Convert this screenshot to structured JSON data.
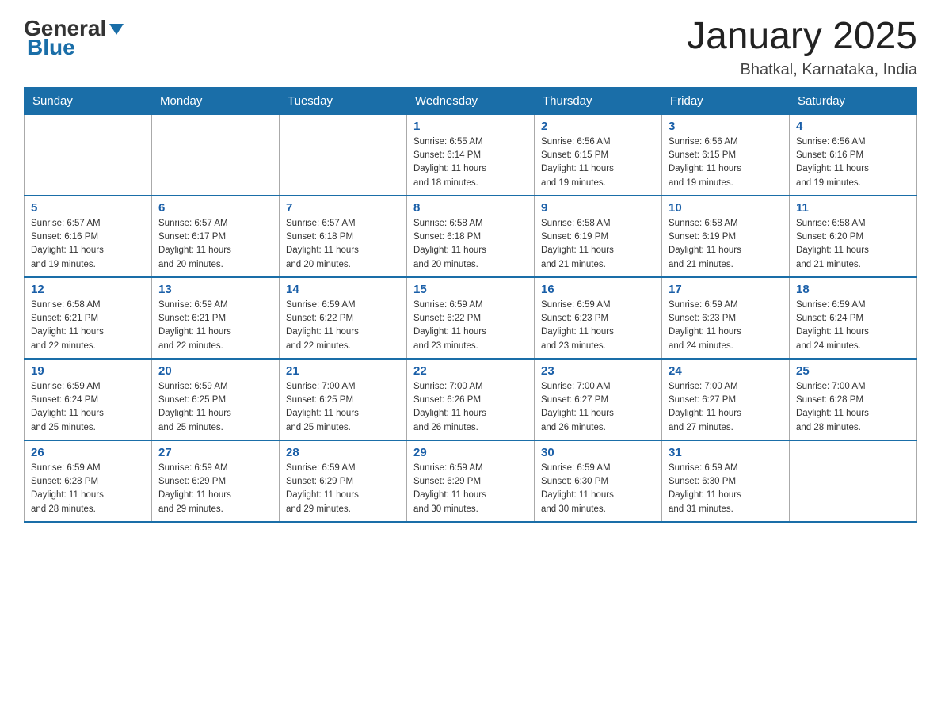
{
  "header": {
    "logo_general": "General",
    "logo_blue": "Blue",
    "month_title": "January 2025",
    "location": "Bhatkal, Karnataka, India"
  },
  "days_of_week": [
    "Sunday",
    "Monday",
    "Tuesday",
    "Wednesday",
    "Thursday",
    "Friday",
    "Saturday"
  ],
  "weeks": [
    [
      {
        "day": "",
        "info": ""
      },
      {
        "day": "",
        "info": ""
      },
      {
        "day": "",
        "info": ""
      },
      {
        "day": "1",
        "info": "Sunrise: 6:55 AM\nSunset: 6:14 PM\nDaylight: 11 hours\nand 18 minutes."
      },
      {
        "day": "2",
        "info": "Sunrise: 6:56 AM\nSunset: 6:15 PM\nDaylight: 11 hours\nand 19 minutes."
      },
      {
        "day": "3",
        "info": "Sunrise: 6:56 AM\nSunset: 6:15 PM\nDaylight: 11 hours\nand 19 minutes."
      },
      {
        "day": "4",
        "info": "Sunrise: 6:56 AM\nSunset: 6:16 PM\nDaylight: 11 hours\nand 19 minutes."
      }
    ],
    [
      {
        "day": "5",
        "info": "Sunrise: 6:57 AM\nSunset: 6:16 PM\nDaylight: 11 hours\nand 19 minutes."
      },
      {
        "day": "6",
        "info": "Sunrise: 6:57 AM\nSunset: 6:17 PM\nDaylight: 11 hours\nand 20 minutes."
      },
      {
        "day": "7",
        "info": "Sunrise: 6:57 AM\nSunset: 6:18 PM\nDaylight: 11 hours\nand 20 minutes."
      },
      {
        "day": "8",
        "info": "Sunrise: 6:58 AM\nSunset: 6:18 PM\nDaylight: 11 hours\nand 20 minutes."
      },
      {
        "day": "9",
        "info": "Sunrise: 6:58 AM\nSunset: 6:19 PM\nDaylight: 11 hours\nand 21 minutes."
      },
      {
        "day": "10",
        "info": "Sunrise: 6:58 AM\nSunset: 6:19 PM\nDaylight: 11 hours\nand 21 minutes."
      },
      {
        "day": "11",
        "info": "Sunrise: 6:58 AM\nSunset: 6:20 PM\nDaylight: 11 hours\nand 21 minutes."
      }
    ],
    [
      {
        "day": "12",
        "info": "Sunrise: 6:58 AM\nSunset: 6:21 PM\nDaylight: 11 hours\nand 22 minutes."
      },
      {
        "day": "13",
        "info": "Sunrise: 6:59 AM\nSunset: 6:21 PM\nDaylight: 11 hours\nand 22 minutes."
      },
      {
        "day": "14",
        "info": "Sunrise: 6:59 AM\nSunset: 6:22 PM\nDaylight: 11 hours\nand 22 minutes."
      },
      {
        "day": "15",
        "info": "Sunrise: 6:59 AM\nSunset: 6:22 PM\nDaylight: 11 hours\nand 23 minutes."
      },
      {
        "day": "16",
        "info": "Sunrise: 6:59 AM\nSunset: 6:23 PM\nDaylight: 11 hours\nand 23 minutes."
      },
      {
        "day": "17",
        "info": "Sunrise: 6:59 AM\nSunset: 6:23 PM\nDaylight: 11 hours\nand 24 minutes."
      },
      {
        "day": "18",
        "info": "Sunrise: 6:59 AM\nSunset: 6:24 PM\nDaylight: 11 hours\nand 24 minutes."
      }
    ],
    [
      {
        "day": "19",
        "info": "Sunrise: 6:59 AM\nSunset: 6:24 PM\nDaylight: 11 hours\nand 25 minutes."
      },
      {
        "day": "20",
        "info": "Sunrise: 6:59 AM\nSunset: 6:25 PM\nDaylight: 11 hours\nand 25 minutes."
      },
      {
        "day": "21",
        "info": "Sunrise: 7:00 AM\nSunset: 6:25 PM\nDaylight: 11 hours\nand 25 minutes."
      },
      {
        "day": "22",
        "info": "Sunrise: 7:00 AM\nSunset: 6:26 PM\nDaylight: 11 hours\nand 26 minutes."
      },
      {
        "day": "23",
        "info": "Sunrise: 7:00 AM\nSunset: 6:27 PM\nDaylight: 11 hours\nand 26 minutes."
      },
      {
        "day": "24",
        "info": "Sunrise: 7:00 AM\nSunset: 6:27 PM\nDaylight: 11 hours\nand 27 minutes."
      },
      {
        "day": "25",
        "info": "Sunrise: 7:00 AM\nSunset: 6:28 PM\nDaylight: 11 hours\nand 28 minutes."
      }
    ],
    [
      {
        "day": "26",
        "info": "Sunrise: 6:59 AM\nSunset: 6:28 PM\nDaylight: 11 hours\nand 28 minutes."
      },
      {
        "day": "27",
        "info": "Sunrise: 6:59 AM\nSunset: 6:29 PM\nDaylight: 11 hours\nand 29 minutes."
      },
      {
        "day": "28",
        "info": "Sunrise: 6:59 AM\nSunset: 6:29 PM\nDaylight: 11 hours\nand 29 minutes."
      },
      {
        "day": "29",
        "info": "Sunrise: 6:59 AM\nSunset: 6:29 PM\nDaylight: 11 hours\nand 30 minutes."
      },
      {
        "day": "30",
        "info": "Sunrise: 6:59 AM\nSunset: 6:30 PM\nDaylight: 11 hours\nand 30 minutes."
      },
      {
        "day": "31",
        "info": "Sunrise: 6:59 AM\nSunset: 6:30 PM\nDaylight: 11 hours\nand 31 minutes."
      },
      {
        "day": "",
        "info": ""
      }
    ]
  ]
}
